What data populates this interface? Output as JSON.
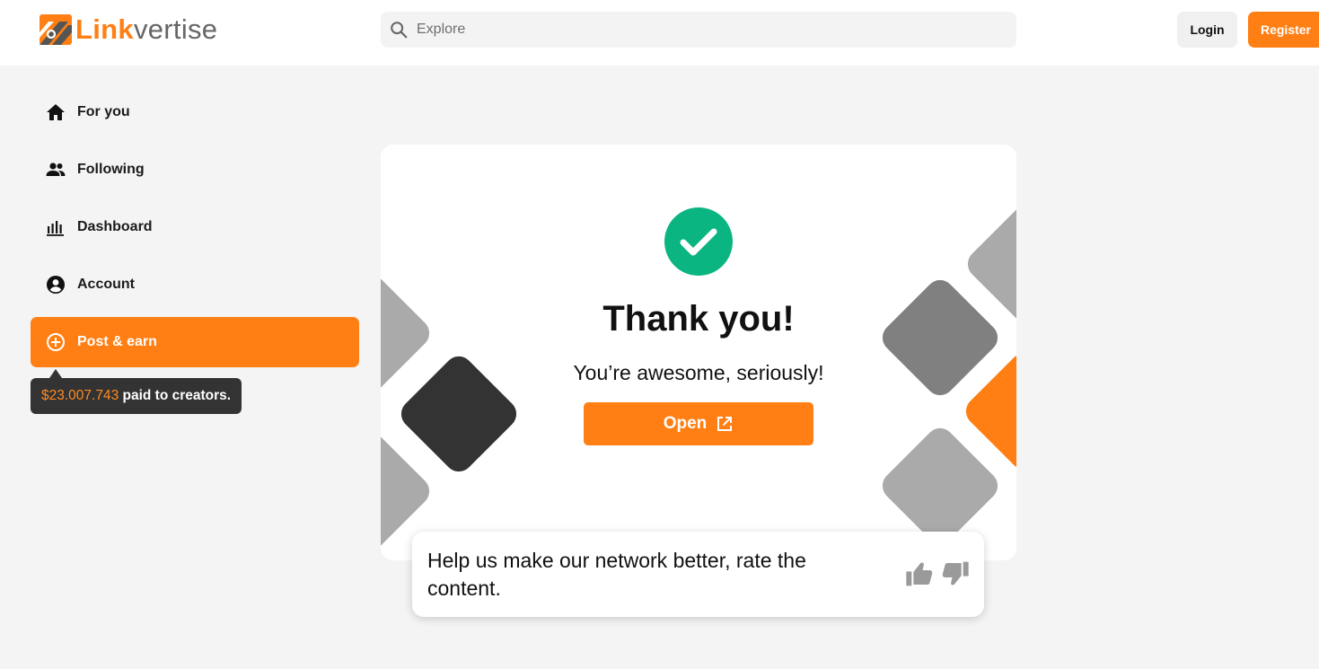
{
  "header": {
    "logo": {
      "part1": "Link",
      "part2": "vertise"
    },
    "search": {
      "placeholder": "Explore",
      "value": ""
    },
    "login_label": "Login",
    "register_label": "Register"
  },
  "sidebar": {
    "items": [
      {
        "label": "For you",
        "icon": "home-icon"
      },
      {
        "label": "Following",
        "icon": "people-icon"
      },
      {
        "label": "Dashboard",
        "icon": "bar-chart-icon"
      },
      {
        "label": "Account",
        "icon": "account-circle-icon"
      },
      {
        "label": "Post & earn",
        "icon": "add-circle-icon",
        "active": true
      }
    ],
    "tooltip": {
      "amount": "$23.007.743",
      "text": " paid to creators."
    }
  },
  "card": {
    "title": "Thank you!",
    "subtitle": "You’re awesome, seriously!",
    "open_label": "Open"
  },
  "rating": {
    "text": "Help us make our network better, rate the content."
  },
  "colors": {
    "accent": "#ff7f14",
    "success": "#0bb582",
    "dark": "#333333",
    "deco_gray": "#aaaaaa",
    "deco_mid": "#808080"
  }
}
